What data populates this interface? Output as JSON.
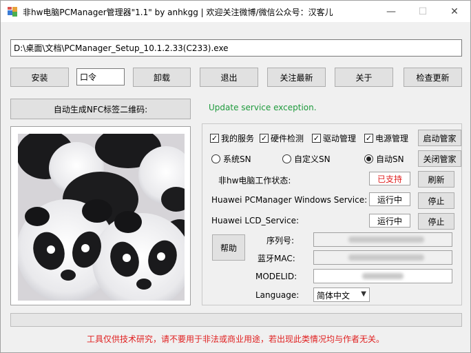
{
  "window": {
    "title": "非hw电脑PCManager管理器\"1.1\" by anhkgg | 欢迎关注微博/微信公众号：汉客儿",
    "minimize_glyph": "—",
    "maximize_glyph": "☐",
    "close_glyph": "✕"
  },
  "path_value": "D:\\桌面\\文档\\PCManager_Setup_10.1.2.33(C233).exe",
  "toolbar": {
    "install": "安装",
    "code_value": "口令",
    "uninstall": "卸载",
    "exit": "退出",
    "follow": "关注最新",
    "about": "关于",
    "check_update": "检查更新"
  },
  "qr_button": "自动生成NFC标签二维码:",
  "status_message": "Update service exception.",
  "checks": {
    "my_service": {
      "label": "我的服务",
      "checked": true
    },
    "hardware": {
      "label": "硬件检测",
      "checked": true
    },
    "driver": {
      "label": "驱动管理",
      "checked": true
    },
    "power": {
      "label": "电源管理",
      "checked": true
    }
  },
  "radios": {
    "system_sn": {
      "label": "系统SN",
      "selected": false
    },
    "custom_sn": {
      "label": "自定义SN",
      "selected": false
    },
    "auto_sn": {
      "label": "自动SN",
      "selected": true
    }
  },
  "buttons": {
    "start_manager": "启动管家",
    "close_manager": "关闭管家",
    "refresh": "刷新",
    "stop1": "停止",
    "stop2": "停止",
    "help": "帮助"
  },
  "status_rows": {
    "work_state_label": "非hw电脑工作状态:",
    "work_state_value": "已支持",
    "pcmanager_service_label": "Huawei PCManager Windows Service:",
    "pcmanager_service_value": "运行中",
    "lcd_service_label": "Huawei LCD_Service:",
    "lcd_service_value": "运行中"
  },
  "fields": {
    "serial_label": "序列号:",
    "bt_mac_label": "蓝牙MAC:",
    "model_label": "MODELID:",
    "language_label": "Language:",
    "language_value": "简体中文"
  },
  "progress": 0,
  "footer_note": "工具仅供技术研究，请不要用于非法或商业用途，若出现此类情况均与作者无关。",
  "colors": {
    "status_green": "#1e9a3c",
    "warning_red": "#e02020"
  }
}
